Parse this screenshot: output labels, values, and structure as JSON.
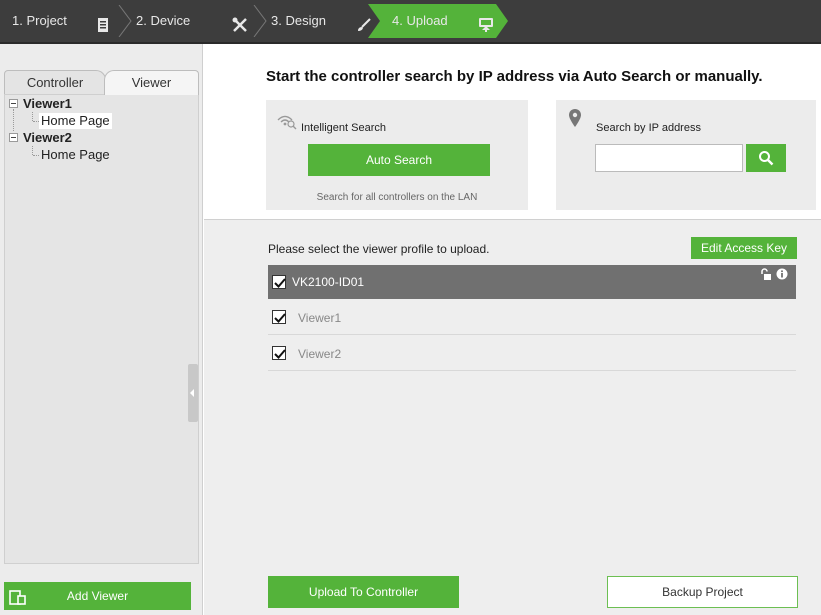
{
  "steps": [
    {
      "label": "1. Project",
      "icon": "document-icon"
    },
    {
      "label": "2. Device",
      "icon": "tools-icon"
    },
    {
      "label": "3. Design",
      "icon": "brush-icon"
    },
    {
      "label": "4. Upload",
      "icon": "upload-icon",
      "active": true
    }
  ],
  "sidebar": {
    "tabs": [
      "Controller",
      "Viewer"
    ],
    "active_tab": "Viewer",
    "tree": [
      {
        "label": "Viewer1",
        "children": [
          "Home Page"
        ]
      },
      {
        "label": "Viewer2",
        "children": [
          "Home Page"
        ]
      }
    ],
    "add_viewer_label": "Add Viewer"
  },
  "main": {
    "headline": "Start the controller search by IP address via Auto Search or manually.",
    "intelligent": {
      "title": "Intelligent Search",
      "button": "Auto Search",
      "note": "Search for all controllers on the LAN"
    },
    "ip_search": {
      "title": "Search by IP address",
      "value": ""
    },
    "profile_prompt": "Please select the viewer profile to upload.",
    "edit_access_key": "Edit Access Key",
    "device": {
      "name": "VK2100-ID01",
      "checked": true
    },
    "viewers": [
      {
        "name": "Viewer1",
        "checked": true
      },
      {
        "name": "Viewer2",
        "checked": true
      }
    ],
    "upload_button": "Upload To Controller",
    "backup_button": "Backup Project"
  },
  "colors": {
    "accent_green": "#54b33a",
    "stepbar_bg": "#3d3d3d",
    "device_row_bg": "#707070"
  }
}
